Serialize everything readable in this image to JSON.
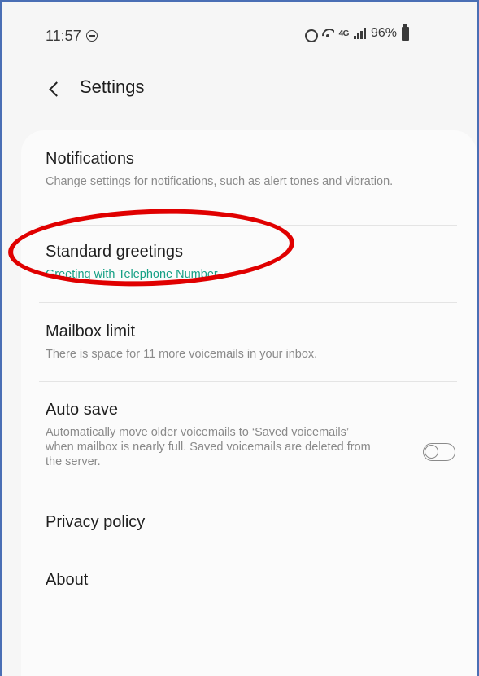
{
  "status_bar": {
    "time": "11:57",
    "network": "4G",
    "battery": "96%"
  },
  "header": {
    "title": "Settings"
  },
  "settings": {
    "notifications": {
      "title": "Notifications",
      "subtitle": "Change settings for notifications, such as alert tones and vibration."
    },
    "standard_greetings": {
      "title": "Standard greetings",
      "subtitle": "Greeting with Telephone Number"
    },
    "mailbox_limit": {
      "title": "Mailbox limit",
      "subtitle": "There is space for 11 more voicemails in your inbox."
    },
    "auto_save": {
      "title": "Auto save",
      "subtitle": "Automatically move older voicemails to ‘Saved voicemails’ when mailbox is nearly full. Saved voicemails are deleted from the server.",
      "enabled": false
    },
    "privacy_policy": {
      "title": "Privacy policy"
    },
    "about": {
      "title": "About"
    }
  },
  "colors": {
    "accent_green": "#16a085",
    "annotation_red": "#e00000",
    "window_border": "#4a6fb5"
  }
}
